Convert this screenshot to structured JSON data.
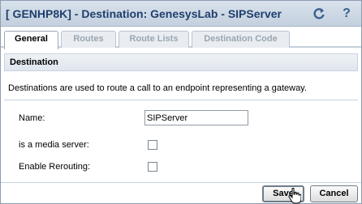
{
  "window": {
    "title": "[ GENHP8K] - Destination: GenesysLab - SIPServer",
    "refresh_icon": "refresh-icon",
    "help_icon": "help-icon",
    "accent_color": "#1f3f6e"
  },
  "tabs": [
    {
      "label": "General",
      "active": true
    },
    {
      "label": "Routes",
      "active": false
    },
    {
      "label": "Route Lists",
      "active": false
    },
    {
      "label": "Destination Code",
      "active": false
    }
  ],
  "section": {
    "title": "Destination",
    "description": "Destinations are used to route a call to an endpoint representing a gateway."
  },
  "form": {
    "name_label": "Name:",
    "name_value": "SIPServer",
    "media_server_label": "is a media server:",
    "media_server_checked": false,
    "rerouting_label": "Enable Rerouting:",
    "rerouting_checked": false
  },
  "footer": {
    "save_label": "Save",
    "cancel_label": "Cancel"
  }
}
